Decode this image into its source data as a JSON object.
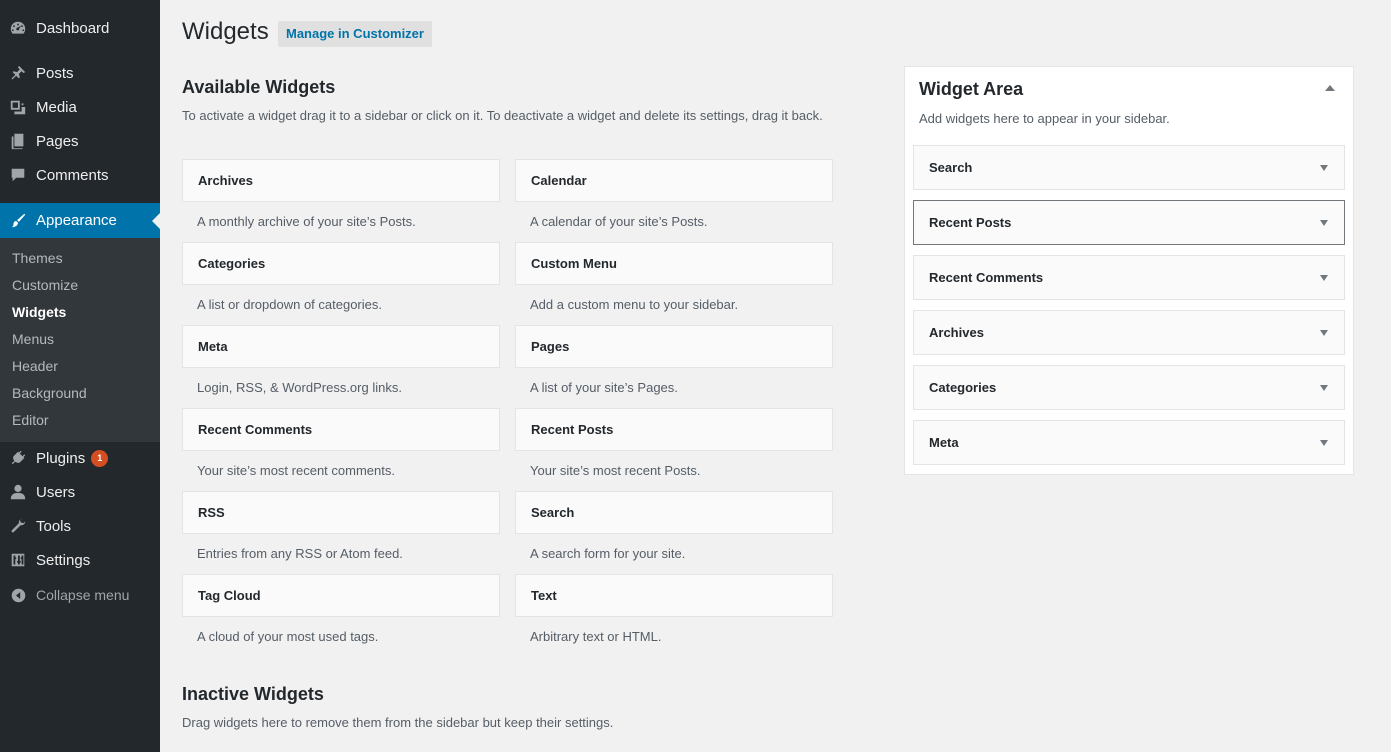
{
  "sidebar": {
    "items": [
      {
        "label": "Dashboard",
        "icon": "dashboard-icon"
      },
      {
        "label": "Posts",
        "icon": "pushpin-icon"
      },
      {
        "label": "Media",
        "icon": "media-icon"
      },
      {
        "label": "Pages",
        "icon": "pages-icon"
      },
      {
        "label": "Comments",
        "icon": "comment-icon"
      },
      {
        "label": "Appearance",
        "icon": "paintbrush-icon",
        "active": true
      },
      {
        "label": "Plugins",
        "icon": "plugin-icon",
        "badge": "1"
      },
      {
        "label": "Users",
        "icon": "user-icon"
      },
      {
        "label": "Tools",
        "icon": "wrench-icon"
      },
      {
        "label": "Settings",
        "icon": "settings-icon"
      }
    ],
    "submenu": [
      "Themes",
      "Customize",
      "Widgets",
      "Menus",
      "Header",
      "Background",
      "Editor"
    ],
    "submenu_current": "Widgets",
    "collapse_label": "Collapse menu"
  },
  "header": {
    "title": "Widgets",
    "customizer_label": "Manage in Customizer"
  },
  "available": {
    "title": "Available Widgets",
    "description": "To activate a widget drag it to a sidebar or click on it. To deactivate a widget and delete its settings, drag it back.",
    "widgets": [
      {
        "name": "Archives",
        "desc": "A monthly archive of your site’s Posts."
      },
      {
        "name": "Calendar",
        "desc": "A calendar of your site’s Posts."
      },
      {
        "name": "Categories",
        "desc": "A list or dropdown of categories."
      },
      {
        "name": "Custom Menu",
        "desc": "Add a custom menu to your sidebar."
      },
      {
        "name": "Meta",
        "desc": "Login, RSS, & WordPress.org links."
      },
      {
        "name": "Pages",
        "desc": "A list of your site’s Pages."
      },
      {
        "name": "Recent Comments",
        "desc": "Your site’s most recent comments."
      },
      {
        "name": "Recent Posts",
        "desc": "Your site’s most recent Posts."
      },
      {
        "name": "RSS",
        "desc": "Entries from any RSS or Atom feed."
      },
      {
        "name": "Search",
        "desc": "A search form for your site."
      },
      {
        "name": "Tag Cloud",
        "desc": "A cloud of your most used tags."
      },
      {
        "name": "Text",
        "desc": "Arbitrary text or HTML."
      }
    ]
  },
  "inactive": {
    "title": "Inactive Widgets",
    "description": "Drag widgets here to remove them from the sidebar but keep their settings."
  },
  "widget_area": {
    "title": "Widget Area",
    "description": "Add widgets here to appear in your sidebar.",
    "widgets": [
      "Search",
      "Recent Posts",
      "Recent Comments",
      "Archives",
      "Categories",
      "Meta"
    ],
    "focused": "Recent Posts"
  },
  "colors": {
    "sidebar_bg": "#23282d",
    "submenu_bg": "#32373c",
    "accent": "#0073aa",
    "badge": "#d54e21",
    "page_bg": "#f1f1f1"
  }
}
